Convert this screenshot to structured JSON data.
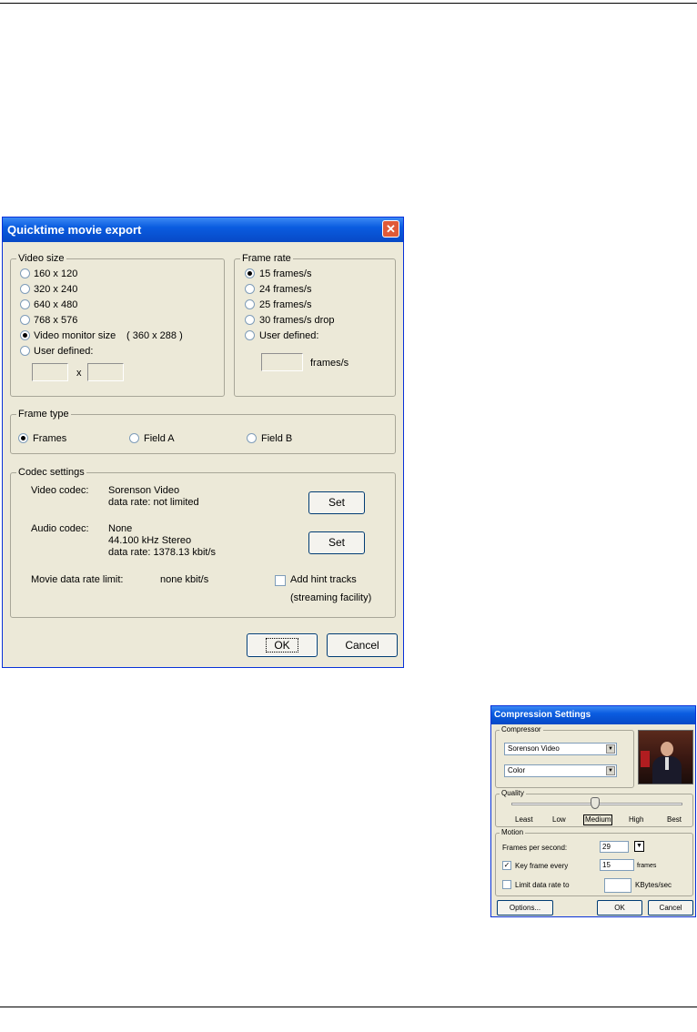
{
  "export_dialog": {
    "title": "Quicktime movie export",
    "close_glyph": "✕",
    "video_size": {
      "label": "Video size",
      "options": [
        "160 x 120",
        "320 x 240",
        "640 x 480",
        "768 x 576",
        "Video monitor size",
        "User defined:"
      ],
      "monitor_size_value": "( 360 x 288 )",
      "selected_index": 4,
      "x_symbol": "x"
    },
    "frame_rate": {
      "label": "Frame rate",
      "options": [
        "15 frames/s",
        "24 frames/s",
        "25 frames/s",
        "30 frames/s drop",
        "User defined:"
      ],
      "selected_index": 0,
      "unit": "frames/s"
    },
    "frame_type": {
      "label": "Frame type",
      "options": [
        "Frames",
        "Field A",
        "Field B"
      ],
      "selected_index": 0
    },
    "codec": {
      "label": "Codec settings",
      "video_label": "Video codec:",
      "video_name": "Sorenson Video",
      "video_rate": "data rate: not limited",
      "audio_label": "Audio codec:",
      "audio_name": "None",
      "audio_format": "44.100 kHz  Stereo",
      "audio_rate": "data rate:  1378.13 kbit/s",
      "set_label": "Set",
      "limit_label": "Movie data rate limit:",
      "limit_value": "none kbit/s",
      "hint_label": "Add  hint tracks",
      "hint_sub": "(streaming facility)"
    },
    "ok_label": "OK",
    "cancel_label": "Cancel"
  },
  "compression_dialog": {
    "title": "Compression Settings",
    "compressor_label": "Compressor",
    "compressor_value": "Sorenson Video",
    "depth_value": "Color",
    "quality_label": "Quality",
    "quality_ticks": [
      "Least",
      "Low",
      "Medium",
      "High",
      "Best"
    ],
    "quality_selected": "Medium",
    "motion_label": "Motion",
    "fps_label": "Frames per second:",
    "fps_value": "29",
    "keyframe_label": "Key frame every",
    "keyframe_value": "15",
    "keyframe_unit": "frames",
    "keyframe_checked": true,
    "limit_label": "Limit data rate to",
    "limit_unit": "KBytes/sec",
    "limit_checked": false,
    "options_label": "Options...",
    "ok_label": "OK",
    "cancel_label": "Cancel"
  }
}
